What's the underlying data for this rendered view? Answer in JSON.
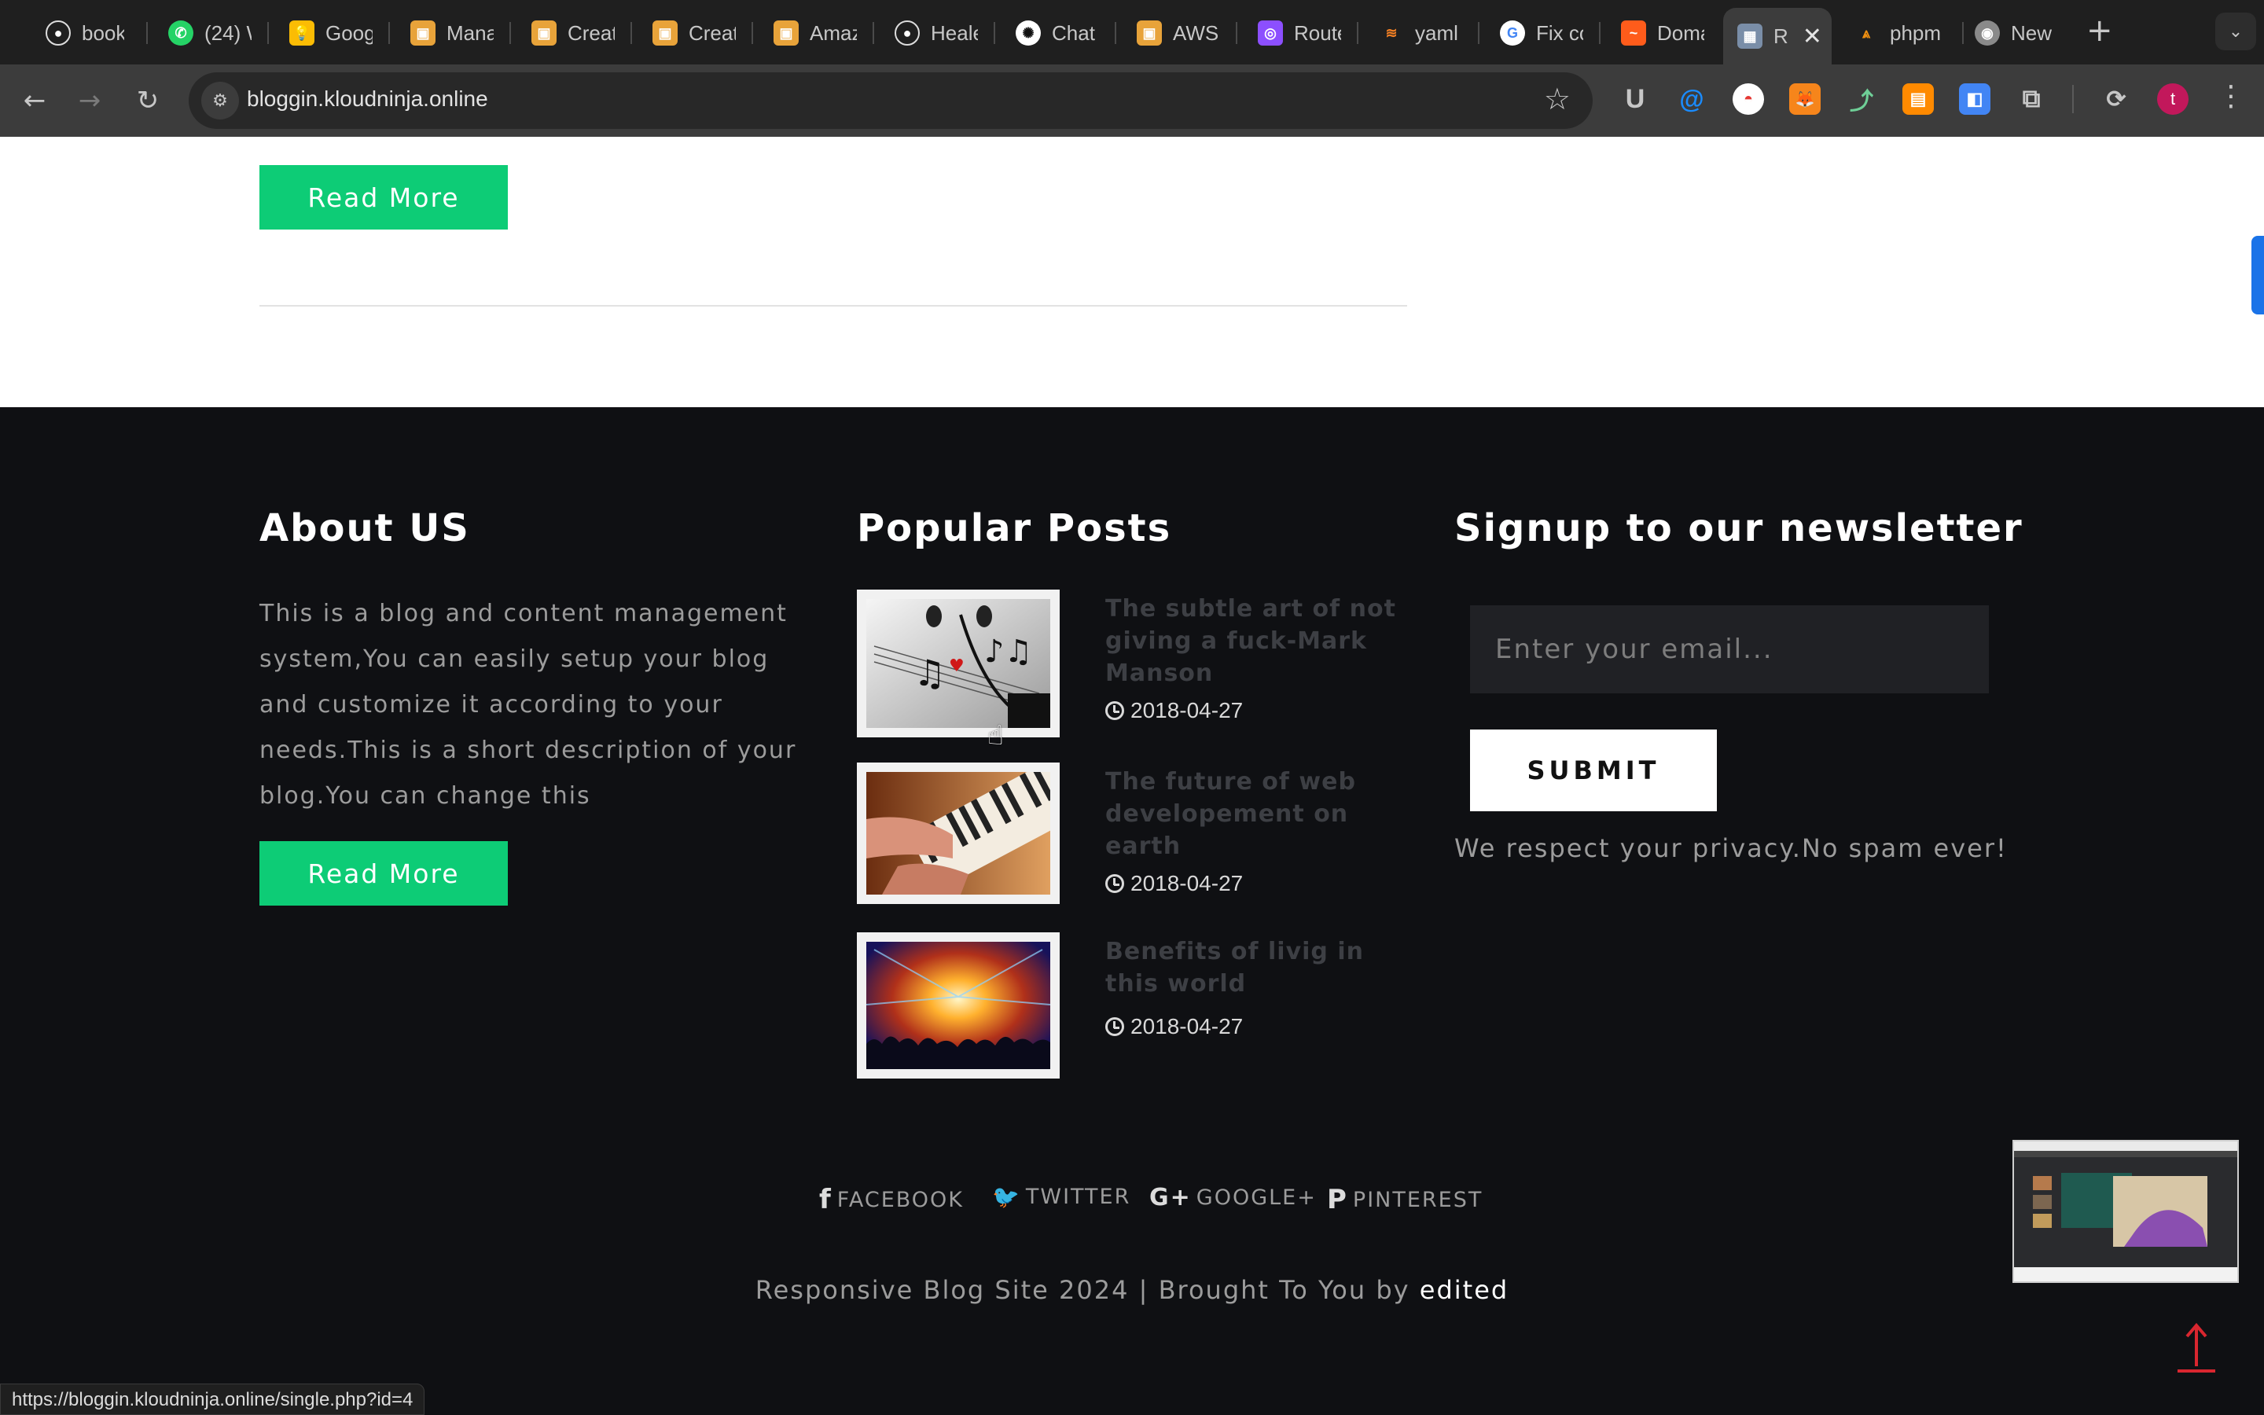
{
  "browser": {
    "tabs": [
      {
        "label": "book",
        "icon": "github-icon"
      },
      {
        "label": "(24) W",
        "icon": "whatsapp-icon"
      },
      {
        "label": "Goog",
        "icon": "google-keep-icon"
      },
      {
        "label": "Mana",
        "icon": "aws-box-icon"
      },
      {
        "label": "Creat",
        "icon": "aws-box-icon"
      },
      {
        "label": "Creat",
        "icon": "aws-box-icon"
      },
      {
        "label": "Amaz",
        "icon": "aws-box-icon"
      },
      {
        "label": "Heale",
        "icon": "github-icon"
      },
      {
        "label": "Chat",
        "icon": "chatgpt-icon"
      },
      {
        "label": "AWS",
        "icon": "aws-box-icon"
      },
      {
        "label": "Route",
        "icon": "route53-icon"
      },
      {
        "label": "yaml",
        "icon": "stackoverflow-icon"
      },
      {
        "label": "Fix co",
        "icon": "google-icon"
      },
      {
        "label": "Doma",
        "icon": "hostinger-icon"
      },
      {
        "label": "R",
        "icon": "site-favicon",
        "active": true
      },
      {
        "label": "phpm",
        "icon": "phpmyadmin-icon"
      },
      {
        "label": "New",
        "icon": "chrome-icon"
      }
    ],
    "new_tab": "+",
    "url": "bloggin.kloudninja.online",
    "status_url": "https://bloggin.kloudninja.online/single.php?id=4"
  },
  "content": {
    "read_more_label": "Read More"
  },
  "footer": {
    "about": {
      "heading": "About US",
      "text": "This is a blog and content management system,You can easily setup your blog and customize it according to your needs.This is a short description of your blog.You can change this",
      "read_more_label": "Read More"
    },
    "popular": {
      "heading": "Popular Posts",
      "posts": [
        {
          "title": "The subtle art of not giving a fuck-Mark Manson",
          "date": "2018-04-27"
        },
        {
          "title": "The future of web developement on earth",
          "date": "2018-04-27"
        },
        {
          "title": "Benefits of livig in this world",
          "date": "2018-04-27"
        }
      ]
    },
    "newsletter": {
      "heading": "Signup to our newsletter",
      "placeholder": "Enter your email...",
      "submit_label": "SUBMIT",
      "privacy": "We respect your privacy.No spam ever!"
    },
    "social": [
      {
        "icon": "f",
        "label": "FACEBOOK"
      },
      {
        "icon": "🐦",
        "label": "TWITTER"
      },
      {
        "icon": "G+",
        "label": "GOOGLE+"
      },
      {
        "icon": "P",
        "label": "PINTEREST"
      }
    ],
    "copyright_prefix": "Responsive Blog Site 2024 | Brought To You by",
    "copyright_brand": "edited"
  },
  "colors": {
    "accent_green": "#0dcc76",
    "footer_bg": "#0f1013",
    "scroll_top_red": "#d9262f"
  }
}
